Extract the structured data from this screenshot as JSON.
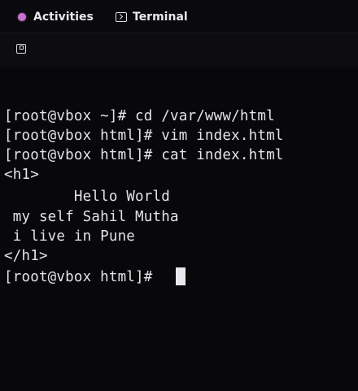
{
  "topbar": {
    "activities_label": "Activities",
    "app_label": "Terminal",
    "activities_dot_color": "#c970d2",
    "terminal_icon": "terminal-icon"
  },
  "headerbar": {
    "newtab_icon": "new-tab-icon"
  },
  "terminal": {
    "lines": [
      "[root@vbox ~]# cd /var/www/html",
      "[root@vbox html]# vim index.html",
      "[root@vbox html]# cat index.html",
      "<h1>",
      "        Hello World",
      " my self Sahil Mutha",
      " i live in Pune",
      "</h1>",
      "[root@vbox html]# "
    ],
    "text_color": "#e4e4e8",
    "background_color": "#08080a"
  }
}
